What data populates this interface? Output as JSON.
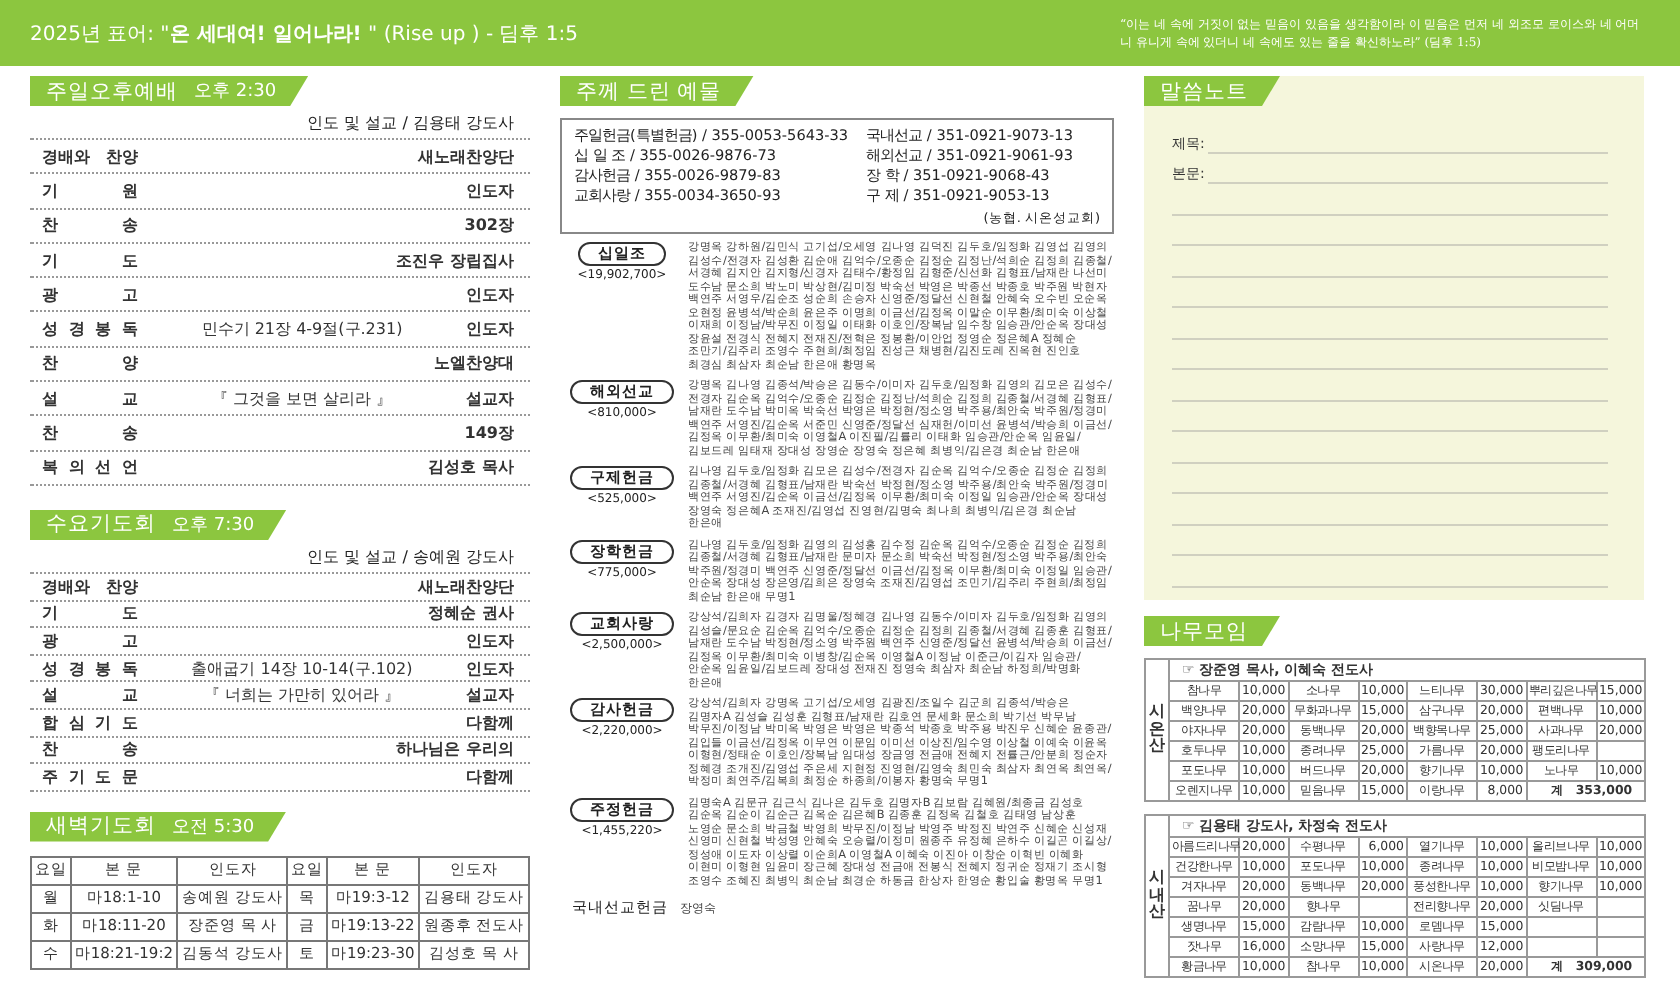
{
  "banner": {
    "motto": "2025년 표어: \"**온 세대여! 일어나라!** \" (Rise up ) - 딤후 1:5",
    "verse": "“이는 네 속에 거짓이 없는 믿음이 있음을 생각함이라 이 믿음은 먼저 네 외조모 로이스와 네 어머니 유니게 속에 있더니 네 속에도 있는 줄을 확신하노라” (딤후 1:5)"
  },
  "sunday_service": {
    "title": "주일오후예배",
    "time": "오후 2:30",
    "leader": "인도 및 설교 / 김용태 강도사",
    "rows": [
      {
        "item": "경배와 찬양",
        "person": "새노래찬양단"
      },
      {
        "item": "기 원",
        "person": "인도자"
      },
      {
        "item": "찬 송",
        "person": "302장"
      },
      {
        "item": "기 도",
        "person": "조진우 장립집사"
      },
      {
        "item": "광 고",
        "person": "인도자"
      },
      {
        "item": "성 경 봉 독",
        "detail": "민수기 21장 4-9절(구.231)",
        "person": "인도자"
      },
      {
        "item": "찬 양",
        "person": "노엘찬양대"
      },
      {
        "item": "설 교",
        "detail": "『 그것을 보면 살리라 』",
        "person": "설교자"
      },
      {
        "item": "찬 송",
        "person": "149장"
      },
      {
        "item": "복 의 선 언",
        "person": "김성호 목사"
      }
    ]
  },
  "wednesday_service": {
    "title": "수요기도회",
    "time": "오후 7:30",
    "leader": "인도 및 설교 / 송예원 강도사",
    "rows": [
      {
        "item": "경배와 찬양",
        "person": "새노래찬양단"
      },
      {
        "item": "기 도",
        "person": "정혜순 권사"
      },
      {
        "item": "광 고",
        "person": "인도자"
      },
      {
        "item": "성 경 봉 독",
        "detail": "출애굽기 14장 10-14(구.102)",
        "person": "인도자"
      },
      {
        "item": "설 교",
        "detail": "『 너희는 가만히 있어라 』",
        "person": "설교자"
      },
      {
        "item": "합 심 기 도",
        "person": "다함께"
      },
      {
        "item": "찬 송",
        "person": "하나님은 우리의"
      },
      {
        "item": "주 기 도 문",
        "person": "다함께"
      }
    ]
  },
  "dawn_prayer": {
    "title": "새벽기도회",
    "time": "오전 5:30",
    "columns": [
      "요일",
      "본 문",
      "인도자",
      "요일",
      "본 문",
      "인도자"
    ],
    "rows": [
      [
        "월",
        "마18:1-10",
        "송예원 강도사",
        "목",
        "마19:3-12",
        "김용태 강도사"
      ],
      [
        "화",
        "마18:11-20",
        "장준영 목 사",
        "금",
        "마19:13-22",
        "원종후 전도사"
      ],
      [
        "수",
        "마18:21-19:2",
        "김동석 강도사",
        "토",
        "마19:23-30",
        "김성호 목 사"
      ]
    ]
  },
  "offerings": {
    "title": "주께 드린 예물",
    "accounts": [
      "주일헌금(특별헌금) / 355-0053-5643-33",
      "국내선교 / 351-0921-9073-13",
      "십 일 조 / 355-0026-9876-73",
      "해외선교 / 351-0921-9061-93",
      "감사헌금 / 355-0026-9879-83",
      "장 학 / 351-0921-9068-43",
      "교회사랑 / 355-0034-3650-93",
      "구 제 / 351-0921-9053-13"
    ],
    "bank_note": "(농협. 시온성교회)",
    "groups": [
      {
        "name": "십일조",
        "amount": "<19,902,700>",
        "donors": "강명옥 강하원/김민식 고기섭/오세영 김나영 김덕진 김두호/임정화 김영섭 김영의 김성수/전경자 김성환 김순애 김억수/오종순 김정순 김정난/석희순 김정희 김종철/서경혜 김지안 김지형/신경자 김태수/황정임 김형준/신선화 김형표/남재란 나선미 도수남 문소희 박노미 박상현/김미정 박숙선 박영은 박종선 박종호 박주원 박현자 백연주 서영우/김순조 성순희 손승자 신영준/정달선 신현철 안혜숙 오수빈 오순옥 오현정 윤병석/박순희 윤은주 이명희 이금선/김정옥 이말순 이무환/최미숙 이상철 이재희 이정남/박무진 이정일 이태화 이호인/장복남 임수창 임승관/안순옥 장대성 장윤설 전경식 전혜지 전재진/전혁은 정봉환/이안업 정영순 정은혜A 정혜순 조만기/김주리 조영수 주현희/최정임 진성근 채병현/김진도레 진옥현 진인호 최경심 최삼자 최순남 한은애 황명옥"
      },
      {
        "name": "해외선교",
        "amount": "<810,000>",
        "donors": "강명옥 김나영 김종석/박승은 김동수/이미자 김두호/임정화 김영의 김모은 김성수/전경자 김순옥 김억수/오종순 김정순 김정난/석희순 김정희 김종철/서경혜 김형표/남재란 도수남 박미옥 박숙선 박영은 박정현/정소영 박주용/최안숙 박주원/정경미 백연주 서영진/김순옥 서준민 신영준/정달선 심재헌/이미선 윤병석/박승희 이금선/김정옥 이무환/최미숙 이영철A 이진필/김률리 이태화 임승관/안순옥 임윤일/김보드레 임태재 장대성 장영순 장영숙 정은혜 최병익/김은경 최순남 한은애"
      },
      {
        "name": "구제헌금",
        "amount": "<525,000>",
        "donors": "김나영 김두호/임정화 김모은 김성수/전경자 김순옥 김억수/오종순 김정순 김정희 김종철/서경혜 김형표/남재란 박숙선 박정현/정소영 박주용/최안숙 박주원/정경미 백연주 서영진/김순옥 이금선/김정옥 이무환/최미숙 이정일 임승관/안순옥 장대성 장영숙 정은혜A 조재진/김영섭 진영현/김명숙 최나희 최병익/김은경 최순남 한은애"
      },
      {
        "name": "장학헌금",
        "amount": "<775,000>",
        "donors": "김나영 김두호/임정화 김영의 김성홍 김수정 김순옥 김억수/오종순 김정순 김정희 김종철/서경혜 김형표/남재란 문미자 문소희 박숙선 박정현/정소영 박주용/최안숙 박주원/정경미 백연주 신영준/정달선 이금선/김정옥 이무환/최미숙 이정일 임승관/안순옥 장대성 장은영/김희은 장영숙 조재진/김영섭 조민기/김주리 주현희/최정임 최순남 한은애 무명1"
      },
      {
        "name": "교회사랑",
        "amount": "<2,500,000>",
        "donors": "강상석/김희자 김경자 김명울/정혜경 김나영 김동수/이미자 김두호/임정화 김영의 김성슬/문요순 김순옥 김억수/오종순 김정순 김정희 김종철/서경혜 김종훈 김형표/남재란 도수남 박정현/정소영 박주원 백연주 신영준/정달선 윤병석/박승희 이금선/김정옥 이무환/최미숙 이병창/김순옥 이영철A 이정남 이준근/이김자 임승관/안순옥 임윤일/김보드레 장대성 전재진 정영숙 최삼자 최순남 하정희/박명화 한은애"
      },
      {
        "name": "감사헌금",
        "amount": "<2,220,000>",
        "donors": "강상석/김희자 강명옥 고기섭/오세영 김광진/조일수 김군희 김종석/박승은 김명자A 김성슬 김성훈 김형표/남재란 김호연 문세화 문소희 박기선 박무남 박무진/이정남 박미옥 박영은 박영은 박종석 박종호 박주용 박진우 신혜순 윤종관/김입들 이금선/김정옥 이무연 이문임 이미선 이상진/임수영 이상철 이예숙 이윤옥 이형현/정태순 이호인/장복남 임대성 장금영 전금애 전혜지 전률근/안분희 정순자 정혜경 조개진/김영섭 주은세 지현정 진영현/김영숙 최민숙 최삼자 최연옥 최연옥/박정미 최연주/김복희 최정순 하종희/이봉자 황명숙 무명1"
      },
      {
        "name": "주정헌금",
        "amount": "<1,455,220>",
        "donors": "김명숙A 김문규 김근식 김나은 김두호 김명자B 김보람 김혜원/최종금 김성호 김순옥 김순이 김순근 김옥순 김은혜B 김종훈 김정옥 김철호 김태영 남상훈 노영순 문소희 박금철 박영희 박무진/이정남 박영주 박정진 박연주 신혜순 신성재 신영미 신현철 박성영 안혜숙 오승렬/이정미 원종주 유정혜 은하수 이길곤 이길상/정성애 이도자 이상렬 이순희A 이영철A 이혜숙 이진아 이창순 이혁빈 이혜화 이현미 이형현 임윤미 장근혜 장대성 전금애 전봉식 전혜지 정귀순 정재기 조시형 조영수 조혜진 최병익 최순남 최경순 하동금 한상자 한영순 황입술 황명옥 무명1"
      }
    ],
    "domestic": {
      "name": "국내선교헌금",
      "donors": "장영숙"
    }
  },
  "sermon_note": {
    "title": "말씀노트",
    "fields": [
      "제목:",
      "본문:"
    ]
  },
  "tree_groups": {
    "title": "나무모임",
    "groups": [
      {
        "mountain": "시온산",
        "leaders": "☞ 장준영 목사, 이혜숙 전도사",
        "rows": [
          [
            {
              "name": "참나무",
              "amount": "10,000"
            },
            {
              "name": "소나무",
              "amount": "10,000"
            },
            {
              "name": "느티나무",
              "amount": "30,000"
            },
            {
              "name": "뿌리깊은나무",
              "amount": "15,000"
            }
          ],
          [
            {
              "name": "백양나무",
              "amount": "20,000"
            },
            {
              "name": "무화과나무",
              "amount": "15,000"
            },
            {
              "name": "삼구나무",
              "amount": "20,000"
            },
            {
              "name": "편백나무",
              "amount": "10,000"
            }
          ],
          [
            {
              "name": "야자나무",
              "amount": "20,000"
            },
            {
              "name": "동백나무",
              "amount": "20,000"
            },
            {
              "name": "백향목나무",
              "amount": "25,000"
            },
            {
              "name": "사과나무",
              "amount": "20,000"
            }
          ],
          [
            {
              "name": "호두나무",
              "amount": "10,000"
            },
            {
              "name": "종려나무",
              "amount": "25,000"
            },
            {
              "name": "가름나무",
              "amount": "20,000"
            },
            {
              "name": "팽도리나무"
            }
          ],
          [
            {
              "name": "포도나무",
              "amount": "10,000"
            },
            {
              "name": "버드나무",
              "amount": "20,000"
            },
            {
              "name": "향기나무",
              "amount": "10,000"
            },
            {
              "name": "노나무",
              "amount": "10,000"
            }
          ],
          [
            {
              "name": "오렌지나무",
              "amount": "10,000"
            },
            {
              "name": "믿음나무",
              "amount": "15,000"
            },
            {
              "name": "이랑나무",
              "amount": "8,000"
            },
            {
              "kind": "total",
              "name": "계",
              "amount": "353,000"
            }
          ]
        ]
      },
      {
        "mountain": "시내산",
        "leaders": "☞ 김용태 강도사, 차정숙 전도사",
        "rows": [
          [
            {
              "name": "아름드리나무",
              "amount": "20,000"
            },
            {
              "name": "수평나무",
              "amount": "6,000"
            },
            {
              "name": "열기나무",
              "amount": "10,000"
            },
            {
              "name": "올리브나무",
              "amount": "10,000"
            }
          ],
          [
            {
              "name": "건강한나무",
              "amount": "10,000"
            },
            {
              "name": "포도나무",
              "amount": "10,000"
            },
            {
              "name": "종려나무",
              "amount": "10,000"
            },
            {
              "name": "비모밤나무",
              "amount": "10,000"
            }
          ],
          [
            {
              "name": "겨자나무",
              "amount": "20,000"
            },
            {
              "name": "동백나무",
              "amount": "20,000"
            },
            {
              "name": "풍성한나무",
              "amount": "10,000"
            },
            {
              "name": "향기나무",
              "amount": "10,000"
            }
          ],
          [
            {
              "name": "꿈나무",
              "amount": "20,000"
            },
            {
              "name": "향나무"
            },
            {
              "name": "전리향나무",
              "amount": "20,000"
            },
            {
              "name": "싯딤나무"
            }
          ],
          [
            {
              "name": "생명나무",
              "amount": "15,000"
            },
            {
              "name": "감람나무",
              "amount": "10,000"
            },
            {
              "name": "로뎀나무",
              "amount": "15,000"
            },
            {
              "kind": "blank"
            }
          ],
          [
            {
              "name": "잣나무",
              "amount": "16,000"
            },
            {
              "name": "소망나무",
              "amount": "15,000"
            },
            {
              "name": "사랑나무",
              "amount": "12,000"
            },
            {
              "kind": "blank"
            }
          ],
          [
            {
              "name": "황금나무",
              "amount": "10,000"
            },
            {
              "name": "참나무",
              "amount": "10,000"
            },
            {
              "name": "시온나무",
              "amount": "20,000"
            },
            {
              "kind": "total",
              "name": "계",
              "amount": "309,000"
            }
          ]
        ]
      }
    ]
  }
}
